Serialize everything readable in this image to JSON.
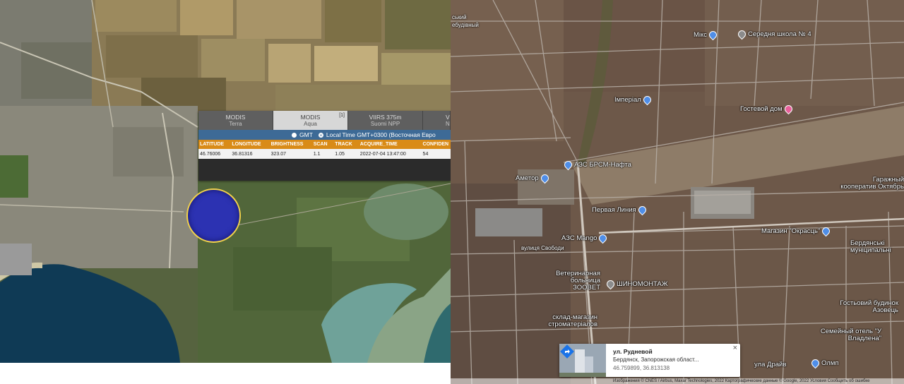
{
  "left_map": {
    "popup": {
      "tabs": [
        {
          "label": "MODIS",
          "sub": "Terra",
          "count": ""
        },
        {
          "label": "MODIS",
          "sub": "Aqua",
          "count": "[1]"
        },
        {
          "label": "VIIRS 375m",
          "sub": "Suomi NPP",
          "count": ""
        },
        {
          "label": "VI",
          "sub": "N",
          "count": ""
        }
      ],
      "time_options": [
        {
          "label": "GMT",
          "checked": false
        },
        {
          "label": "Local Time GMT+0300 (Восточная Евро",
          "checked": true
        }
      ],
      "columns": [
        "LATITUDE",
        "LONGITUDE",
        "BRIGHTNESS",
        "SCAN",
        "TRACK",
        "ACQUIRE_TIME",
        "CONFIDEN"
      ],
      "row": [
        "46.76006",
        "36.81316",
        "323.07",
        "1.1",
        "1.05",
        "2022-07-04 13:47:00",
        "54"
      ]
    },
    "marker_color": "#2c32b2",
    "marker_border": "#f2d24a"
  },
  "right_map": {
    "pois": [
      {
        "label": "Мікс",
        "pin": "blue"
      },
      {
        "label": "Середня школа № 4",
        "pin": "gray"
      },
      {
        "label": "Імперіал",
        "pin": "blue"
      },
      {
        "label": "Гостевой дом",
        "pin": "pink"
      },
      {
        "label": "АЗС БРСМ-Нафта",
        "pin": "blue"
      },
      {
        "label": "Аметор",
        "pin": "blue"
      },
      {
        "label": "Первая Линия",
        "pin": "blue"
      },
      {
        "label": "Гаражный кооператив Октябрь",
        "pin": "gray"
      },
      {
        "label": "АЗС Mango",
        "pin": "blue"
      },
      {
        "label": "Магазин \"Окрасць\"",
        "pin": "blue"
      },
      {
        "label": "Бердянські мунiципальнi",
        "pin": "gray"
      },
      {
        "label": "Ветеринарная больница ЗООВЕТ",
        "pin": "gray"
      },
      {
        "label": "ШИНОМОНТАЖ",
        "pin": "gray"
      },
      {
        "label": "склад-магазин стромaтеpiалов",
        "pin": "blue"
      },
      {
        "label": "Гостьовий будинок Азовець",
        "pin": "pink"
      },
      {
        "label": "Семейный отель \"У Владлена\"",
        "pin": "pink"
      },
      {
        "label": "Олмп",
        "pin": "blue"
      },
      {
        "label": "ула Драйв",
        "pin": "gray"
      }
    ],
    "streets": [
      "вулиця Свободи",
      "ський",
      "ебудівный"
    ],
    "address_card": {
      "title": "ул. Рудневой",
      "subtitle": "Бердянск, Запорожская област...",
      "coords": "46.759899, 36.813138",
      "close": "×"
    },
    "footer": "Изображения © CNES / Airbus, Maxar Technologies, 2022 Картографические данные © Google, 2022   Условия   Сообщить об ошибке"
  }
}
